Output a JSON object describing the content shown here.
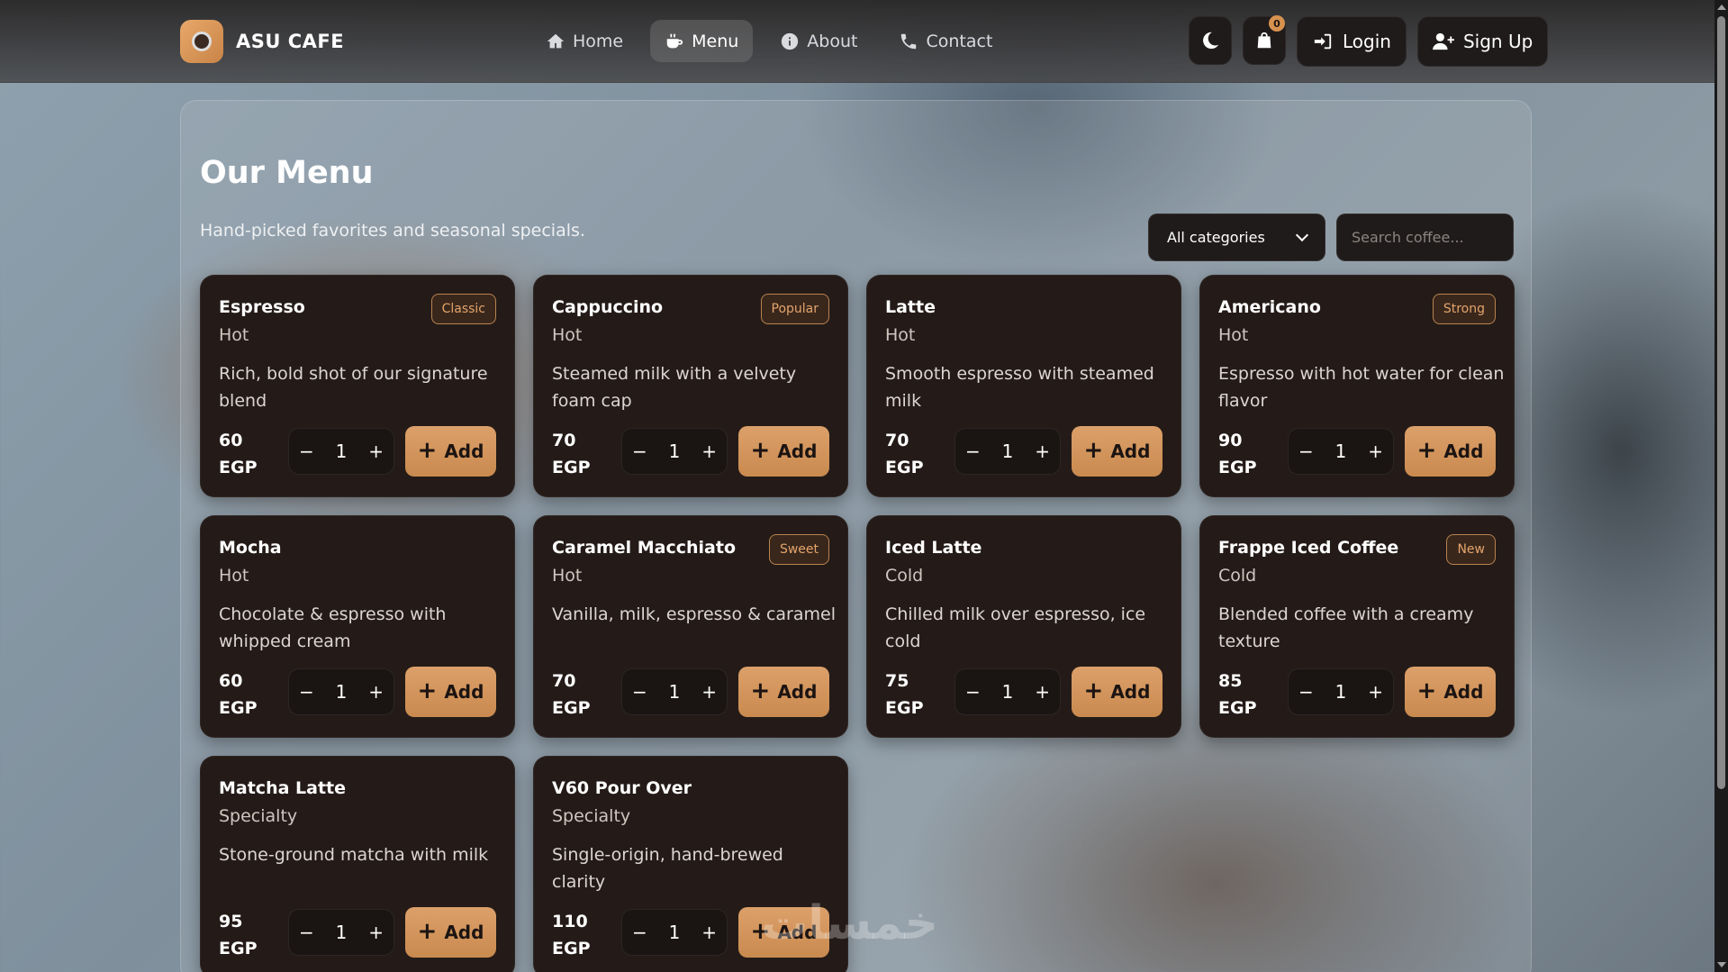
{
  "brand": {
    "name": "ASU CAFE"
  },
  "nav": [
    {
      "label": "Home",
      "icon": "home-icon",
      "active": false
    },
    {
      "label": "Menu",
      "icon": "coffee-icon",
      "active": true
    },
    {
      "label": "About",
      "icon": "info-icon",
      "active": false
    },
    {
      "label": "Contact",
      "icon": "phone-icon",
      "active": false
    }
  ],
  "actions": {
    "theme_icon": "moon-icon",
    "cart_icon": "bag-icon",
    "cart_count": "0",
    "login_label": "Login",
    "signup_label": "Sign Up"
  },
  "page": {
    "title": "Our Menu",
    "subtitle": "Hand-picked favorites and seasonal specials."
  },
  "filters": {
    "category_selected": "All categories",
    "search_placeholder": "Search coffee..."
  },
  "add_label": "Add",
  "items": [
    {
      "name": "Espresso",
      "tag": "Classic",
      "type": "Hot",
      "desc": "Rich, bold shot of our signature blend",
      "price": "60",
      "currency": "EGP",
      "qty": "1"
    },
    {
      "name": "Cappuccino",
      "tag": "Popular",
      "type": "Hot",
      "desc": "Steamed milk with a velvety foam cap",
      "price": "70",
      "currency": "EGP",
      "qty": "1"
    },
    {
      "name": "Latte",
      "tag": "",
      "type": "Hot",
      "desc": "Smooth espresso with steamed milk",
      "price": "70",
      "currency": "EGP",
      "qty": "1"
    },
    {
      "name": "Americano",
      "tag": "Strong",
      "type": "Hot",
      "desc": "Espresso with hot water for clean flavor",
      "price": "90",
      "currency": "EGP",
      "qty": "1"
    },
    {
      "name": "Mocha",
      "tag": "",
      "type": "Hot",
      "desc": "Chocolate & espresso with whipped cream",
      "price": "60",
      "currency": "EGP",
      "qty": "1"
    },
    {
      "name": "Caramel Macchiato",
      "tag": "Sweet",
      "type": "Hot",
      "desc": "Vanilla, milk, espresso & caramel",
      "price": "70",
      "currency": "EGP",
      "qty": "1"
    },
    {
      "name": "Iced Latte",
      "tag": "",
      "type": "Cold",
      "desc": "Chilled milk over espresso, ice cold",
      "price": "75",
      "currency": "EGP",
      "qty": "1"
    },
    {
      "name": "Frappe Iced Coffee",
      "tag": "New",
      "type": "Cold",
      "desc": "Blended coffee with a creamy texture",
      "price": "85",
      "currency": "EGP",
      "qty": "1"
    },
    {
      "name": "Matcha Latte",
      "tag": "",
      "type": "Specialty",
      "desc": "Stone-ground matcha with milk",
      "price": "95",
      "currency": "EGP",
      "qty": "1"
    },
    {
      "name": "V60 Pour Over",
      "tag": "",
      "type": "Specialty",
      "desc": "Single-origin, hand-brewed clarity",
      "price": "110",
      "currency": "EGP",
      "qty": "1"
    }
  ],
  "watermark": "خمسات"
}
